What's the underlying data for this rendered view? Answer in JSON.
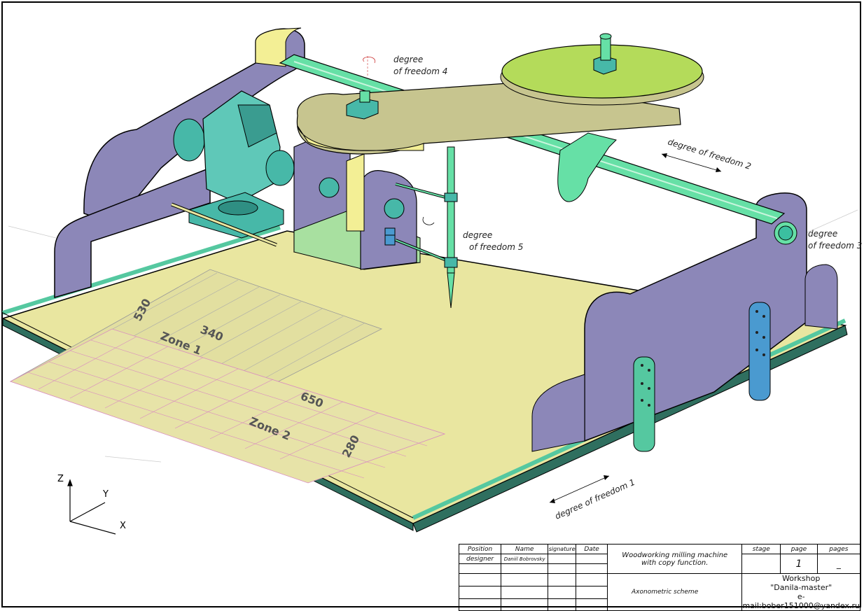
{
  "drawing": {
    "labels": {
      "dof4": [
        "degree",
        "of freedom 4"
      ],
      "dof2": "degree of freedom 2",
      "dof3": [
        "degree",
        "of freedom 3"
      ],
      "dof5": [
        "degree",
        "of freedom 5"
      ],
      "dof1": "degree of freedom 1",
      "zone1": "Zone 1",
      "zone2": "Zone 2",
      "dim_530": "530",
      "dim_340": "340",
      "dim_650": "650",
      "dim_280": "280"
    },
    "axes": {
      "z": "Z",
      "y": "Y",
      "x": "X"
    },
    "colors": {
      "base": "#e9e6a0",
      "side_panel": "#8c87b8",
      "panel_edge": "#f3ef95",
      "shaft": "#66e0a6",
      "rail": "#55c8a0",
      "arm": "#c7c58f",
      "disc": "#b4db5a",
      "router": "#47b8a8",
      "bracket": "#4a9ad0",
      "zone_hatch": "#9999bb",
      "zone_grid": "#d98cc0"
    }
  },
  "title_block": {
    "headers": {
      "position": "Position",
      "name": "Name",
      "signature": "signature",
      "date": "Date",
      "stage": "stage",
      "page": "page",
      "pages": "pages"
    },
    "designer_role": "designer",
    "designer_name": "Daniil Bobrovsky",
    "title_lines": [
      "Woodworking milling machine",
      "with copy function."
    ],
    "page_value": "1",
    "pages_value": "_",
    "scheme": "Axonometric scheme",
    "workshop_lines": [
      "Workshop",
      "\"Danila-master\"",
      "e-mail:bober151000@yandex.ru"
    ]
  }
}
